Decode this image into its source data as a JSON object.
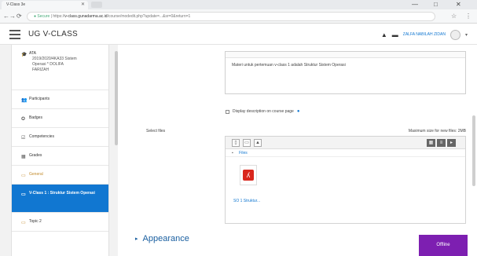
{
  "browser": {
    "tab_title": "V-Class 3e",
    "url_secure": "Secure",
    "url_domain": "v-class.gunadarma.ac.id",
    "url_path": "/course/modedit.php?update=...&sr=0&return=1",
    "window_controls": [
      "—",
      "□",
      "✕"
    ]
  },
  "header": {
    "brand": "UG V-CLASS",
    "user_name": "ZALFA NABILAH ZIDAN"
  },
  "drawer": {
    "items": [
      {
        "icon": "mortarboard-icon",
        "lines": [
          "ATA",
          "2019/2020/4KA33 Sistem",
          "Operasi * DOLIFA",
          "FARIZAH"
        ],
        "kind": "course"
      },
      {
        "icon": "users-icon",
        "label": "Participants",
        "kind": "normal"
      },
      {
        "icon": "badge-icon",
        "label": "Badges",
        "kind": "normal"
      },
      {
        "icon": "competencies-icon",
        "label": "Competencies",
        "kind": "normal"
      },
      {
        "icon": "grades-icon",
        "label": "Grades",
        "kind": "normal"
      },
      {
        "icon": "folder-icon",
        "label": "General",
        "kind": "section"
      },
      {
        "icon": "folder-icon",
        "label": "V-Class 1 : Struktur Sistem Operasi",
        "kind": "active"
      },
      {
        "icon": "folder-icon",
        "label": "Topic 2",
        "kind": "normal"
      }
    ]
  },
  "main": {
    "description_text": "Materi untuk pertemuan v-class 1 adalah Struktur Sistem Operasi",
    "display_description_label": "Display description on course page",
    "select_files_label": "Select files",
    "max_size_text": "Maximum size for new files: 2MB",
    "path_label": "Files",
    "file_name": "SO 1 Struktur...",
    "appearance_label": "Appearance",
    "offline_label": "Offline"
  }
}
